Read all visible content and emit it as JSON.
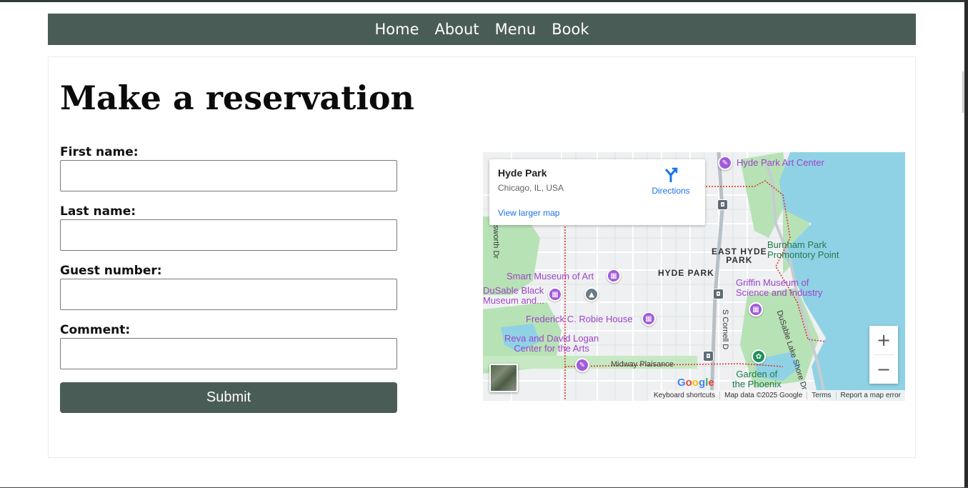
{
  "nav": {
    "items": [
      "Home",
      "About",
      "Menu",
      "Book"
    ]
  },
  "page": {
    "title": "Make a reservation"
  },
  "form": {
    "fields": [
      {
        "label": "First name:",
        "value": ""
      },
      {
        "label": "Last name:",
        "value": ""
      },
      {
        "label": "Guest number:",
        "value": ""
      },
      {
        "label": "Comment:",
        "value": ""
      }
    ],
    "submit_label": "Submit"
  },
  "map": {
    "place": {
      "name": "Hyde Park",
      "address": "Chicago, IL, USA",
      "directions_label": "Directions",
      "larger_map_label": "View larger map"
    },
    "poi": {
      "art_center": "Hyde Park Art Center",
      "smart_museum": "Smart Museum of Art",
      "dusable_1": "DuSable Black",
      "dusable_2": "Museum and...",
      "robie": "Frederick C. Robie House",
      "logan_1": "Reva and David Logan",
      "logan_2": "Center for the Arts",
      "burnham_1": "Burnham Park",
      "burnham_2": "Promontory Point",
      "griffin_1": "Griffin Museum of",
      "griffin_2": "Science and Industry",
      "phoenix_1": "Garden of",
      "phoenix_2": "the Phoenix"
    },
    "areas": {
      "east_hyde_1": "EAST HYDE",
      "east_hyde_2": "PARK",
      "hyde_park": "HYDE PARK"
    },
    "roads": {
      "midway": "Midway Plaisance",
      "cornell": "S Cornell D",
      "lake_shore": "DuSable Lake Shore Dr",
      "ellsworth": "sworth Dr"
    },
    "zoom_in": "+",
    "zoom_out": "−",
    "logo": "Google",
    "attribution": [
      "Keyboard shortcuts",
      "Map data ©2025 Google",
      "Terms",
      "Report a map error"
    ]
  },
  "colors": {
    "nav_bg": "#4a5c56",
    "water": "#8fd2e6",
    "park": "#b7e2b5",
    "poi_purple": "#9d45c6",
    "link_blue": "#1a73e8"
  }
}
